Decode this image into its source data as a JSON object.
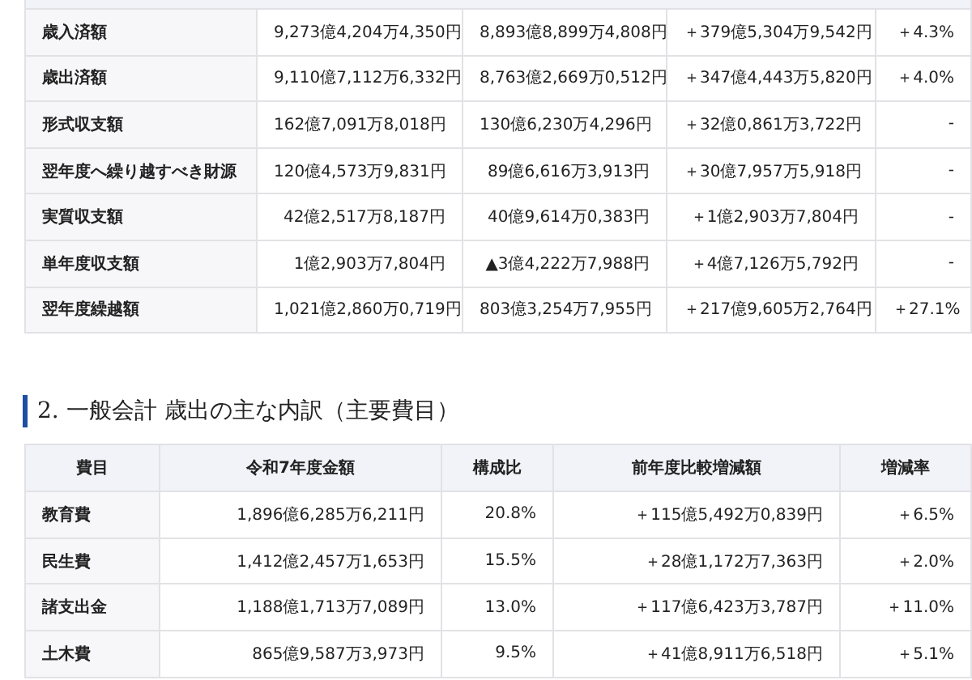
{
  "summary_table": {
    "rows": [
      {
        "label": "歳入済額",
        "values": [
          "9,273億4,204万4,350円",
          "8,893億8,899万4,808円",
          "＋379億5,304万9,542円",
          "＋4.3%"
        ]
      },
      {
        "label": "歳出済額",
        "values": [
          "9,110億7,112万6,332円",
          "8,763億2,669万0,512円",
          "＋347億4,443万5,820円",
          "＋4.0%"
        ]
      },
      {
        "label": "形式収支額",
        "values": [
          "162億7,091万8,018円",
          "130億6,230万4,296円",
          "＋32億0,861万3,722円",
          "-"
        ]
      },
      {
        "label": "翌年度へ繰り越すべき財源",
        "values": [
          "120億4,573万9,831円",
          "89億6,616万3,913円",
          "＋30億7,957万5,918円",
          "-"
        ]
      },
      {
        "label": "実質収支額",
        "values": [
          "42億2,517万8,187円",
          "40億9,614万0,383円",
          "＋1億2,903万7,804円",
          "-"
        ]
      },
      {
        "label": "単年度収支額",
        "values": [
          "1億2,903万7,804円",
          "▲3億4,222万7,988円",
          "＋4億7,126万5,792円",
          "-"
        ]
      },
      {
        "label": "翌年度繰越額",
        "values": [
          "1,021億2,860万0,719円",
          "803億3,254万7,955円",
          "＋217億9,605万2,764円",
          "＋27.1%"
        ]
      }
    ]
  },
  "section_heading": "2. 一般会計 歳出の主な内訳（主要費目）",
  "expenditure_table": {
    "columns": [
      "費目",
      "令和7年度金額",
      "構成比",
      "前年度比較増減額",
      "増減率"
    ],
    "rows": [
      {
        "label": "教育費",
        "values": [
          "1,896億6,285万6,211円",
          "20.8%",
          "＋115億5,492万0,839円",
          "＋6.5%"
        ]
      },
      {
        "label": "民生費",
        "values": [
          "1,412億2,457万1,653円",
          "15.5%",
          "＋28億1,172万7,363円",
          "＋2.0%"
        ]
      },
      {
        "label": "諸支出金",
        "values": [
          "1,188億1,713万7,089円",
          "13.0%",
          "＋117億6,423万3,787円",
          "＋11.0%"
        ]
      },
      {
        "label": "土木費",
        "values": [
          "865億9,587万3,973円",
          "9.5%",
          "＋41億8,911万6,518円",
          "＋5.1%"
        ]
      }
    ]
  }
}
